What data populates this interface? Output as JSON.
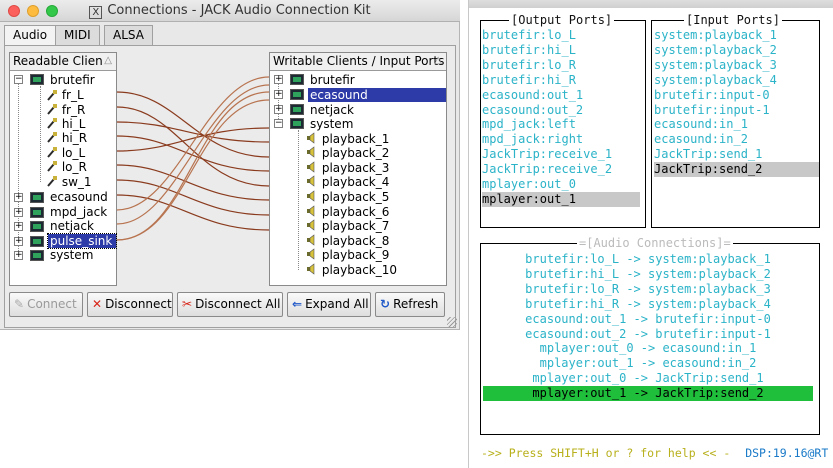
{
  "jack": {
    "title": "Connections - JACK Audio Connection Kit",
    "title_icon": "X",
    "tabs": [
      "Audio",
      "MIDI",
      "ALSA"
    ],
    "readable_header": "Readable Clien",
    "writable_header": "Writable Clients / Input Ports",
    "readable": {
      "brutefir": "brutefir",
      "ports": [
        "fr_L",
        "fr_R",
        "hi_L",
        "hi_R",
        "lo_L",
        "lo_R",
        "sw_1"
      ],
      "ecasound": "ecasound",
      "mpd_jack": "mpd_jack",
      "netjack": "netjack",
      "pulse_sink": "pulse_sink",
      "system": "system"
    },
    "writable": {
      "brutefir": "brutefir",
      "ecasound": "ecasound",
      "netjack": "netjack",
      "system": "system",
      "ports": [
        "playback_1",
        "playback_2",
        "playback_3",
        "playback_4",
        "playback_5",
        "playback_6",
        "playback_7",
        "playback_8",
        "playback_9",
        "playback_10"
      ]
    },
    "buttons": {
      "connect": "Connect",
      "disconnect": "Disconnect",
      "disconnect_all": "Disconnect All",
      "expand_all": "Expand All",
      "refresh": "Refresh"
    },
    "colors": {
      "selection": "#2d3ba8",
      "wire": "#8a3b1e",
      "wire_alt": "#b87450"
    }
  },
  "term": {
    "output_title": "[Output Ports]",
    "input_title": "[Input Ports]",
    "connections_title": "=[Audio Connections]=",
    "output_ports": [
      "brutefir:lo_L",
      "brutefir:hi_L",
      "brutefir:lo_R",
      "brutefir:hi_R",
      "ecasound:out_1",
      "ecasound:out_2",
      "mpd_jack:left",
      "mpd_jack:right",
      "JackTrip:receive_1",
      "JackTrip:receive_2",
      "mplayer:out_0",
      "mplayer:out_1"
    ],
    "input_ports": [
      "system:playback_1",
      "system:playback_2",
      "system:playback_3",
      "system:playback_4",
      "brutefir:input-0",
      "brutefir:input-1",
      "ecasound:in_1",
      "ecasound:in_2",
      "JackTrip:send_1",
      "JackTrip:send_2"
    ],
    "connections": [
      "brutefir:lo_L -> system:playback_1",
      "brutefir:hi_L -> system:playback_2",
      "brutefir:lo_R -> system:playback_3",
      "brutefir:hi_R -> system:playback_4",
      "ecasound:out_1 -> brutefir:input-0",
      "ecasound:out_2 -> brutefir:input-1",
      "mplayer:out_0 -> ecasound:in_1",
      "mplayer:out_1 -> ecasound:in_2",
      "mplayer:out_0 -> JackTrip:send_1",
      "mplayer:out_1 -> JackTrip:send_2"
    ],
    "footer_hint": "->> Press SHIFT+H or ? for help << -",
    "dsp": "DSP:19.16@RT",
    "colors": {
      "text": "#2bb3c8",
      "highlight_grey": "#c8c8c8",
      "highlight_green": "#1fbf3c",
      "hint": "#b8b01c",
      "dsp": "#1a7ac8"
    }
  }
}
